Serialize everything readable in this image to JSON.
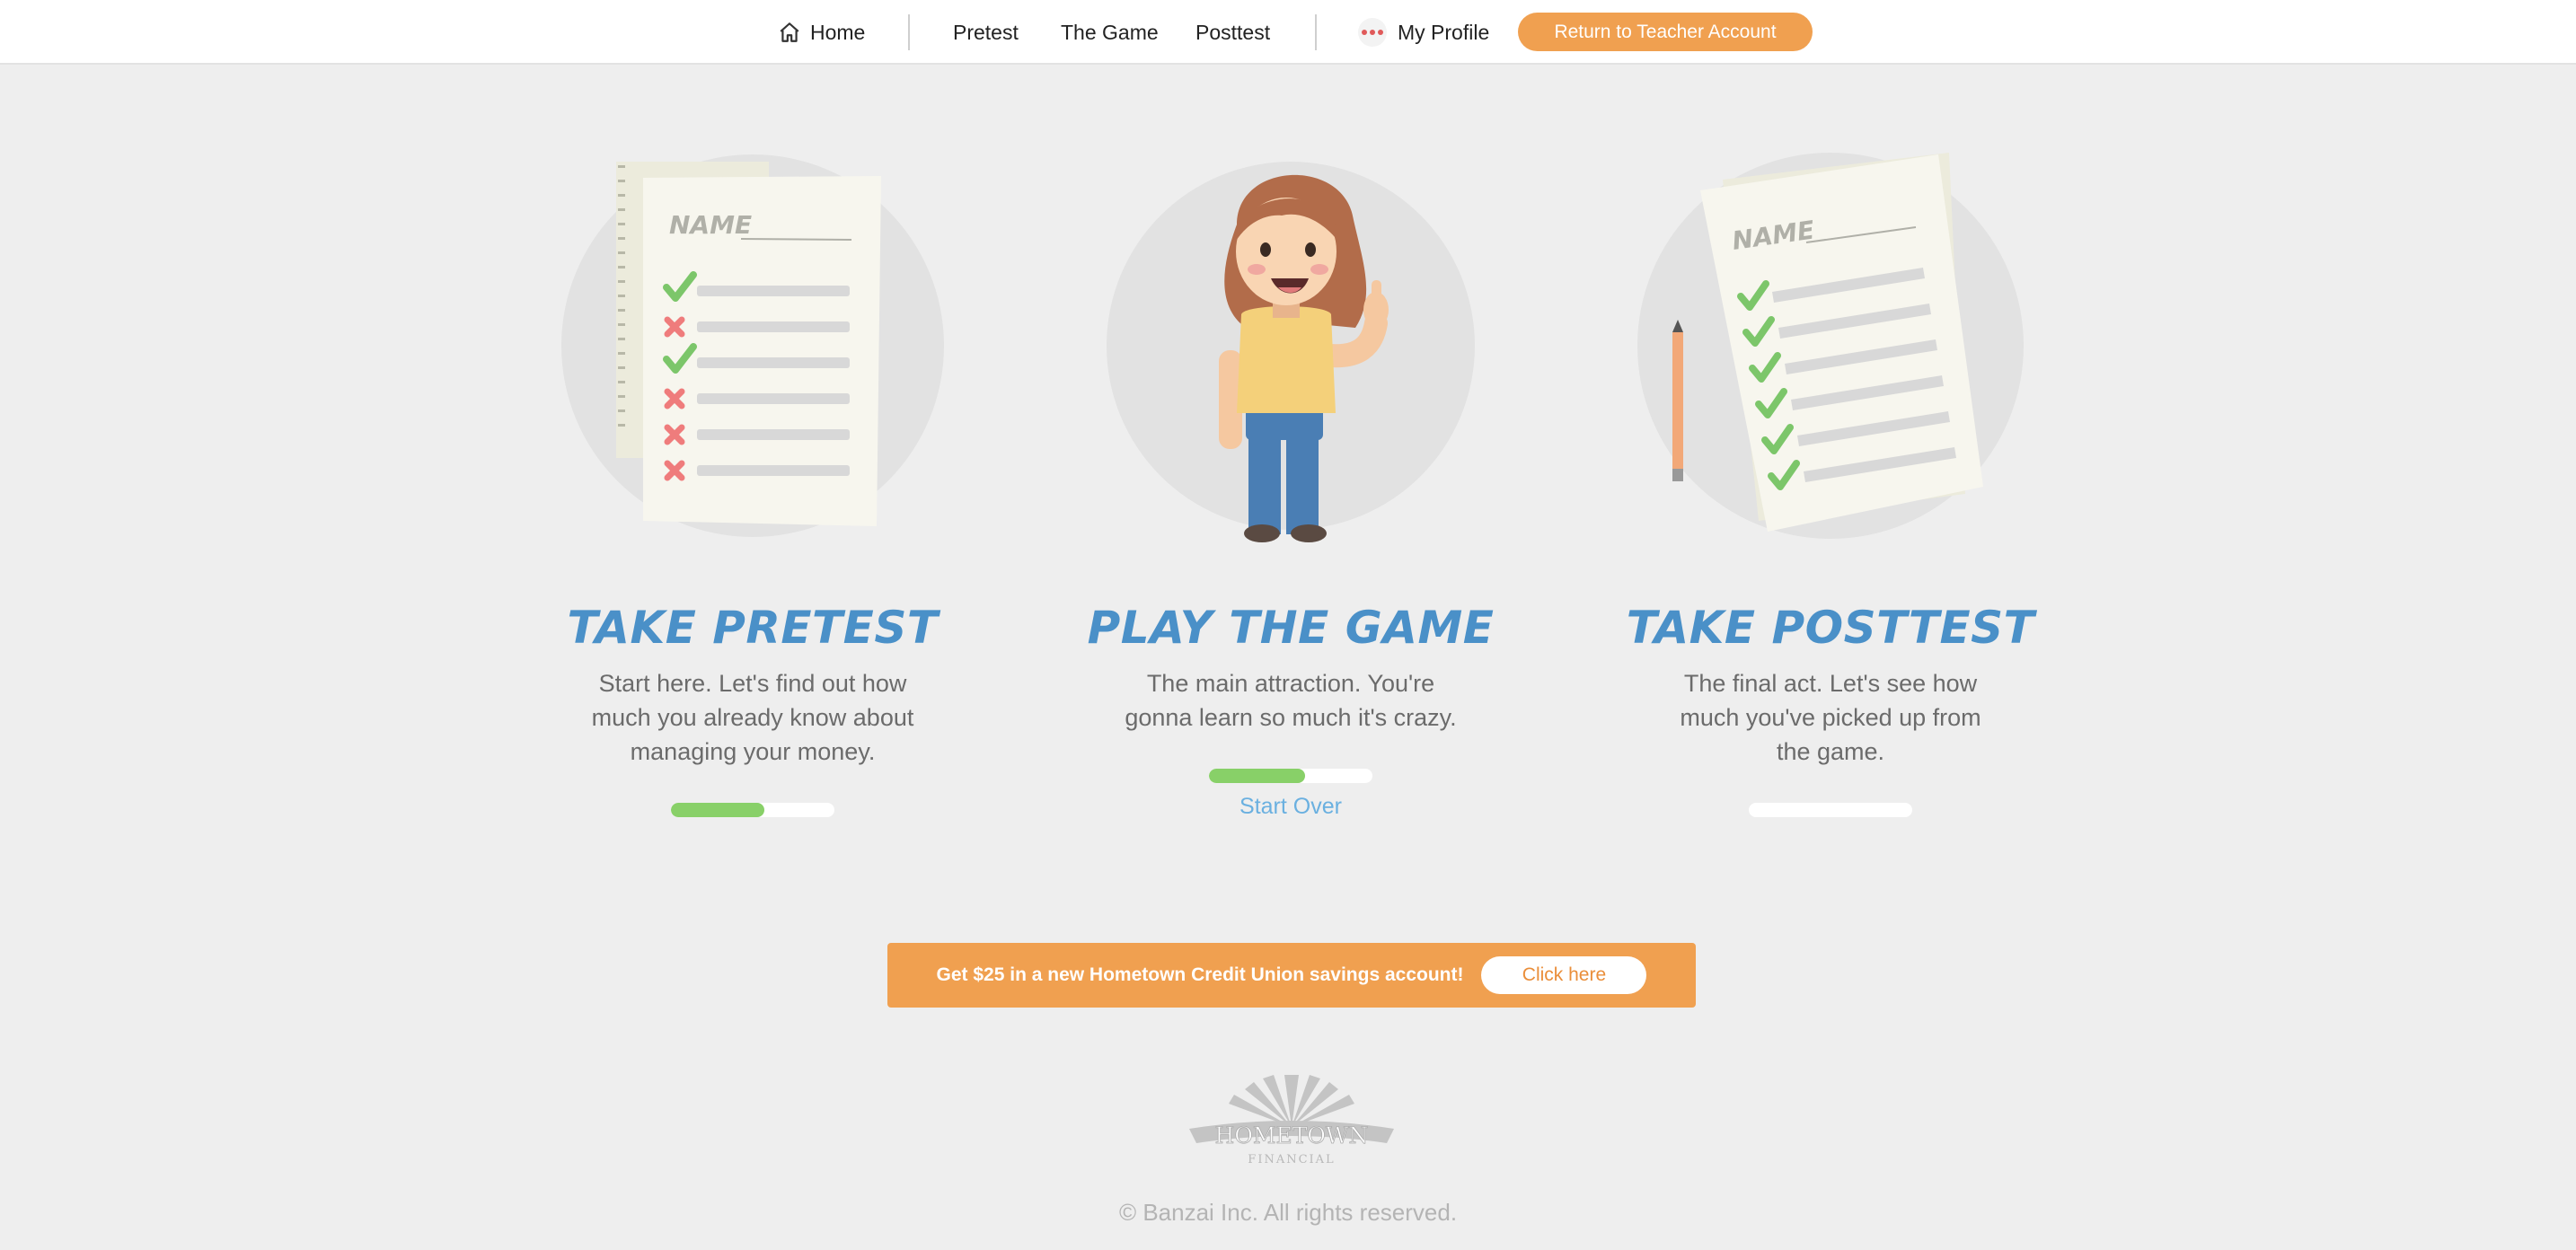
{
  "nav": {
    "home": "Home",
    "pretest": "Pretest",
    "game": "The Game",
    "posttest": "Posttest",
    "profile": "My Profile",
    "teacher_button": "Return to Teacher Account"
  },
  "columns": [
    {
      "title": "TAKE PRETEST",
      "description": "Start here. Let's find out how much you already know about managing your money.",
      "progress": 0.57,
      "illustration": "pretest-sheet-icon"
    },
    {
      "title": "PLAY THE GAME",
      "description": "The main attraction. You're gonna learn so much it's crazy.",
      "progress": 0.59,
      "illustration": "game-character",
      "link": "Start Over"
    },
    {
      "title": "TAKE POSTTEST",
      "description": "The final act. Let's see how much you've picked up from the game.",
      "progress": 0,
      "illustration": "posttest-sheet-icon"
    }
  ],
  "promo": {
    "text_prefix": "Get ",
    "amount": "$25",
    "text_suffix": " in a new Hometown Credit Union savings account!",
    "button": "Click here"
  },
  "footer": {
    "logo_text": "HOMETOWN",
    "logo_subtext": "FINANCIAL",
    "copyright": "© Banzai Inc. All rights reserved."
  },
  "colors": {
    "accent": "#f0a050",
    "title_blue": "#4a90c8",
    "progress_green": "#88d068",
    "link_blue": "#6ab0e0"
  }
}
